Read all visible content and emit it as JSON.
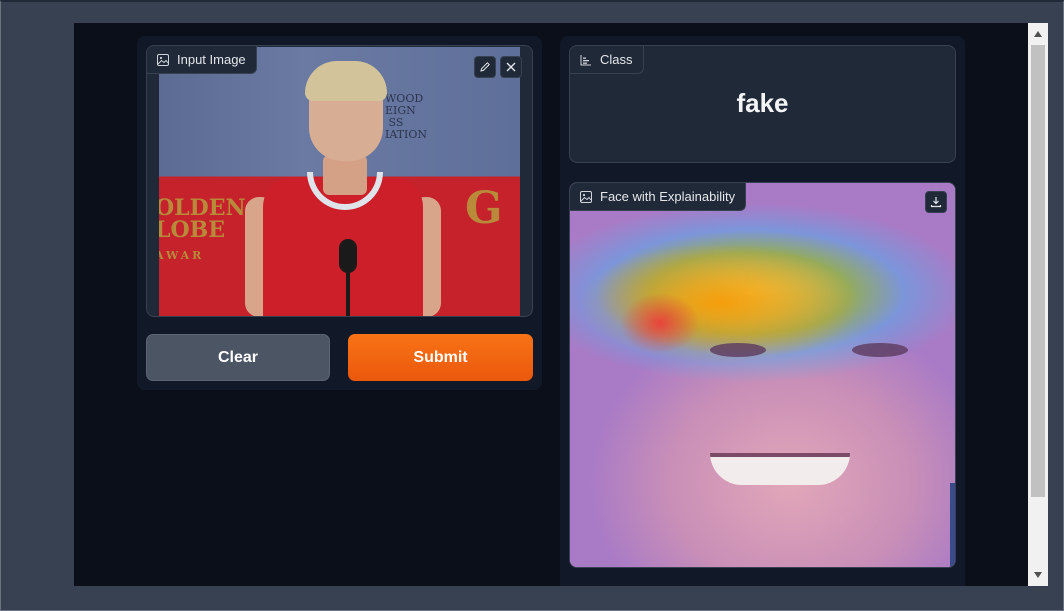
{
  "input_panel": {
    "label": "Input Image",
    "label_icon": "image-icon",
    "edit_icon": "pencil-icon",
    "close_icon": "close-icon",
    "clear_label": "Clear",
    "submit_label": "Submit",
    "submit_color": "#f97316"
  },
  "class_panel": {
    "label": "Class",
    "label_icon": "bar-chart-icon",
    "value": "fake"
  },
  "explain_panel": {
    "label": "Face with Explainability",
    "label_icon": "image-icon",
    "download_icon": "download-icon"
  },
  "photo_text": {
    "logo_left": "OLDEN\nLOBE\nAWAR",
    "logo_right": "G",
    "logo_top": "WOOD\nEIGN\nSS\nIATION"
  }
}
